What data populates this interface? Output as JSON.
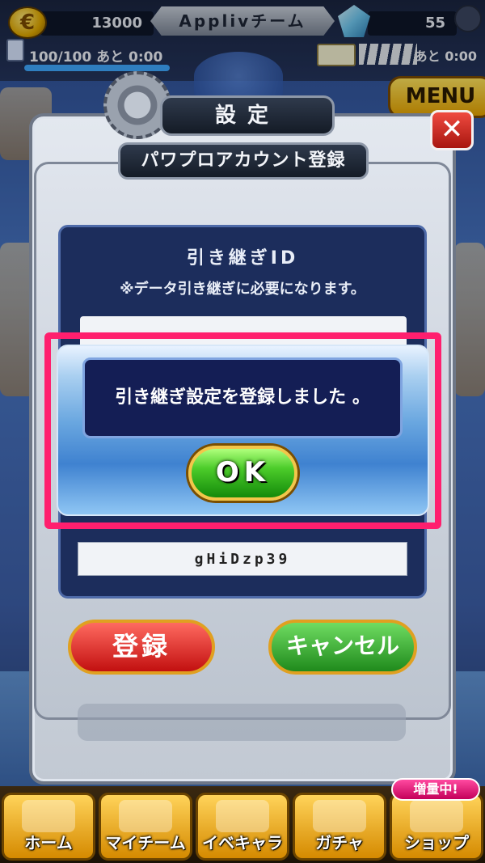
{
  "status_bar": {
    "coins": "13000",
    "team_name": "Applivチーム",
    "gems": "55",
    "stamina": "100/100",
    "stamina_recover_label": "あと 0:00",
    "stamina_fraction": 1.0,
    "ticket_recover_label": "あと 0:00"
  },
  "background": {
    "menu_label": "MENU"
  },
  "settings_panel": {
    "title": "設定",
    "subtitle": "パワプロアカウント登録",
    "id_label": "引き継ぎID",
    "id_note": "※データ引き継ぎに必要になります。",
    "password_value": "gHiDzp39",
    "register_label": "登録",
    "cancel_label": "キャンセル"
  },
  "modal": {
    "message": "引き継ぎ設定を登録しました 。",
    "ok_label": "OK"
  },
  "bottom_nav": {
    "badge": "増量中!",
    "items": [
      {
        "label": "ホーム"
      },
      {
        "label": "マイチーム"
      },
      {
        "label": "イベキャラ"
      },
      {
        "label": "ガチャ"
      },
      {
        "label": "ショップ"
      }
    ]
  },
  "colors": {
    "highlight_outline": "#ff1f6e",
    "message_box": "#141e55",
    "ok_button": "#4ccc2a"
  }
}
